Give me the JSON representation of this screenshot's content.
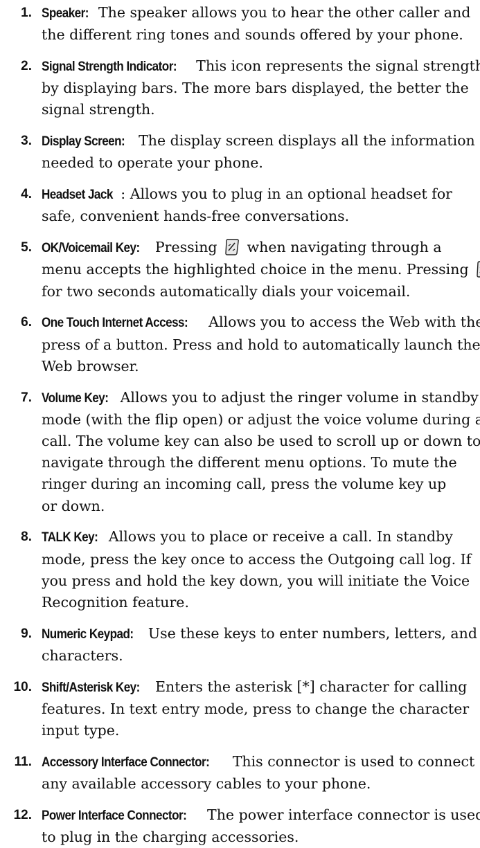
{
  "items": [
    {
      "number": "1.",
      "term": "Speaker:",
      "lines": [
        "The speaker allows you to hear the other caller and",
        "the different ring tones and sounds offered by your phone."
      ]
    },
    {
      "number": "2.",
      "term": "Signal Strength Indicator:",
      "lines": [
        "This icon represents the signal strength",
        "by displaying bars. The more bars displayed, the better the",
        "signal strength."
      ]
    },
    {
      "number": "3.",
      "term": "Display Screen:",
      "lines": [
        "The display screen displays all the information",
        "needed to operate your phone."
      ]
    },
    {
      "number": "4.",
      "term": "Headset Jack",
      "term_suffix": ":",
      "lines": [
        "Allows you to plug in an optional headset for",
        "safe, convenient hands-free conversations."
      ]
    },
    {
      "number": "5.",
      "term": "OK/Voicemail Key:",
      "line1_before_icon": "Pressing",
      "line1_after_icon": "when navigating through a",
      "line2_before_icon": "menu accepts the highlighted choice in the menu. Pressing",
      "line3": "for two seconds automatically dials your voicemail.",
      "icon": "ok-voicemail-key-icon"
    },
    {
      "number": "6.",
      "term": "One Touch Internet Access:",
      "lines": [
        "Allows you to access the Web with the",
        "press of a button. Press and hold to automatically launch the",
        "Web browser."
      ]
    },
    {
      "number": "7.",
      "term": "Volume Key:",
      "lines": [
        "Allows you to adjust the ringer volume in standby",
        "mode (with the flip open) or adjust the voice volume during a",
        "call. The volume key can also be used to scroll up or down to",
        "navigate through the different menu options. To mute the",
        "ringer during an incoming call, press the volume key up",
        "or down."
      ]
    },
    {
      "number": "8.",
      "term": "TALK Key:",
      "lines": [
        "Allows you to place or receive a call. In standby",
        "mode, press the key once to access the Outgoing call log. If",
        "you press and hold the key down, you will initiate the Voice",
        "Recognition feature."
      ]
    },
    {
      "number": "9.",
      "term": "Numeric Keypad:",
      "lines": [
        "Use these keys to enter numbers, letters, and",
        "characters."
      ]
    },
    {
      "number": "10.",
      "term": "Shift/Asterisk Key:",
      "lines": [
        "Enters the asterisk [*] character for calling",
        "features. In text entry mode, press to change the character",
        "input type."
      ]
    },
    {
      "number": "11.",
      "term": "Accessory Interface Connector:",
      "lines": [
        "This connector is used to connect",
        "any available accessory cables to your phone."
      ]
    },
    {
      "number": "12.",
      "term": "Power Interface Connector:",
      "lines": [
        "The power interface connector is used",
        "to plug in the charging accessories."
      ]
    }
  ]
}
